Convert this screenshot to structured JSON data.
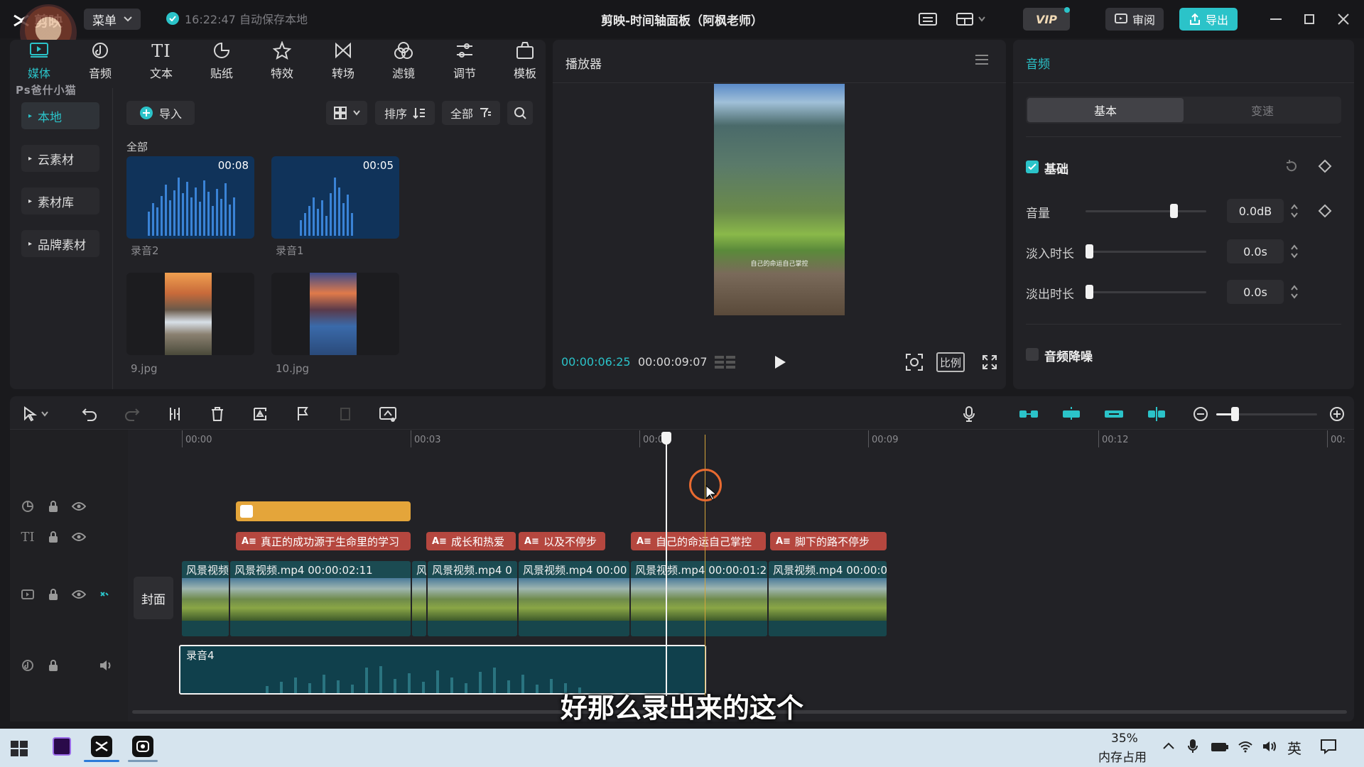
{
  "app": {
    "logo": "剪映",
    "menu_label": "菜单",
    "autosave_text": "16:22:47 自动保存本地",
    "window_title": "剪映-时间轴面板（阿枫老师）",
    "vip_label": "VIP",
    "review_label": "审阅",
    "export_label": "导出",
    "watermark": "Ps爸什小猫"
  },
  "media_tools": [
    {
      "label": "媒体",
      "icon": "media-icon"
    },
    {
      "label": "音频",
      "icon": "audio-icon"
    },
    {
      "label": "文本",
      "icon": "text-icon"
    },
    {
      "label": "贴纸",
      "icon": "sticker-icon"
    },
    {
      "label": "特效",
      "icon": "effects-icon"
    },
    {
      "label": "转场",
      "icon": "transition-icon"
    },
    {
      "label": "滤镜",
      "icon": "filter-icon"
    },
    {
      "label": "调节",
      "icon": "adjust-icon"
    },
    {
      "label": "模板",
      "icon": "template-icon"
    }
  ],
  "sidebar": {
    "items": [
      {
        "label": "本地"
      },
      {
        "label": "云素材"
      },
      {
        "label": "素材库"
      },
      {
        "label": "品牌素材"
      }
    ]
  },
  "media": {
    "import_label": "导入",
    "sort_label": "排序",
    "filter_label": "全部",
    "section_label": "全部",
    "items": [
      {
        "name": "录音2",
        "duration": "00:08",
        "type": "audio"
      },
      {
        "name": "录音1",
        "duration": "00:05",
        "type": "audio"
      },
      {
        "name": "9.jpg",
        "duration": "",
        "type": "image"
      },
      {
        "name": "10.jpg",
        "duration": "",
        "type": "image"
      }
    ]
  },
  "player": {
    "title": "播放器",
    "current_time": "00:00:06:25",
    "total_time": "00:00:09:07",
    "ratio_label": "比例",
    "frame_caption": "自己的命运自己掌控"
  },
  "properties": {
    "title": "音频",
    "tabs": [
      "基本",
      "变速"
    ],
    "basic_label": "基础",
    "volume_label": "音量",
    "volume_value": "0.0dB",
    "volume_level": 0.75,
    "fade_in_label": "淡入时长",
    "fade_in_value": "0.0s",
    "fade_out_label": "淡出时长",
    "fade_out_value": "0.0s",
    "denoise_label": "音频降噪"
  },
  "timeline": {
    "ruler": [
      "00:00",
      "00:03",
      "00:0",
      "00:09",
      "00:12",
      "00:"
    ],
    "cover_label": "封面",
    "text_clips": [
      "真正的成功源于生命里的学习",
      "成长和热爱",
      "以及不停步",
      "自己的命运自己掌控",
      "脚下的路不停步"
    ],
    "video_clips": [
      "风景视频",
      "风景视频.mp4   00:00:02:11",
      "风",
      "风景视频.mp4   0",
      "风景视频.mp4   00:00",
      "风景视频.mp4   00:00:01:2",
      "风景视频.mp4   00:00:0"
    ],
    "audio_clip": "录音4"
  },
  "subtitle": "好那么录出来的这个",
  "taskbar": {
    "memory_percent": "35%",
    "memory_label": "内存占用",
    "ime": "英"
  },
  "colors": {
    "accent": "#2bc3c9",
    "text_clip": "#b5473f",
    "sticker_clip": "#e4a53a",
    "audio_clip": "#10404c"
  }
}
